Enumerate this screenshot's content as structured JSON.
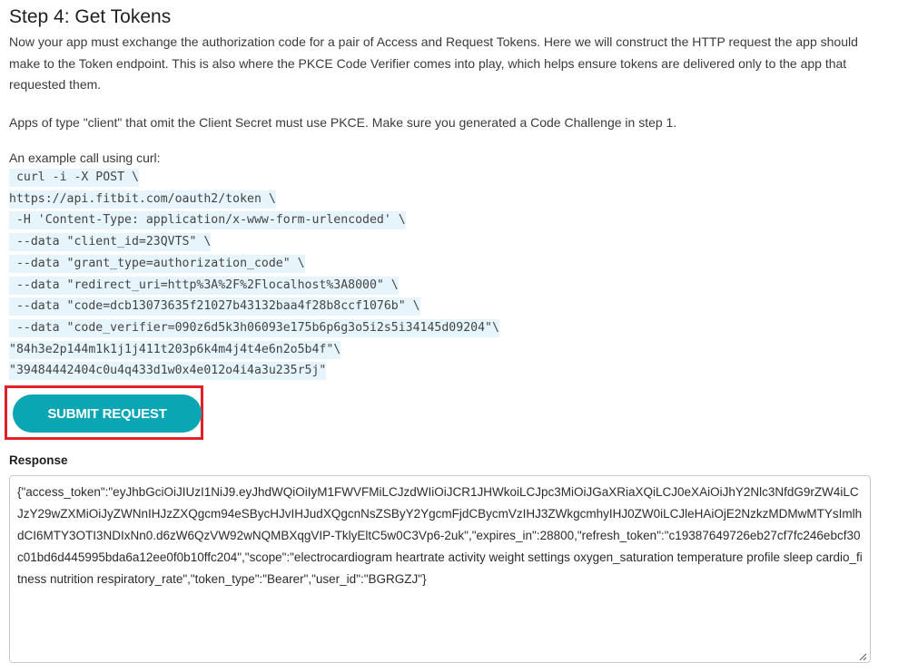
{
  "step": {
    "title": "Step 4: Get Tokens",
    "intro": "Now your app must exchange the authorization code for a pair of Access and Request Tokens. Here we will construct the HTTP request the app should make to the Token endpoint. This is also where the PKCE Code Verifier comes into play, which helps ensure tokens are delivered only to the app that requested them.",
    "pkce_note": "Apps of type \"client\" that omit the Client Secret must use PKCE. Make sure you generated a Code Challenge in step 1.",
    "example_label": "An example call using curl:"
  },
  "code": {
    "lines": [
      " curl -i -X POST \\",
      "https://api.fitbit.com/oauth2/token \\",
      " -H 'Content-Type: application/x-www-form-urlencoded' \\",
      " --data \"client_id=23QVTS\" \\",
      " --data \"grant_type=authorization_code\" \\",
      " --data \"redirect_uri=http%3A%2F%2Flocalhost%3A8000\" \\",
      " --data \"code=dcb13073635f21027b43132baa4f28b8ccf1076b\" \\",
      " --data \"code_verifier=090z6d5k3h06093e175b6p6g3o5i2s5i34145d09204\"\\",
      "\"84h3e2p144m1k1j1j411t203p6k4m4j4t4e6n2o5b4f\"\\",
      "\"39484442404c0u4q433d1w0x4e012o4i4a3u235r5j\""
    ]
  },
  "actions": {
    "submit_label": "SUBMIT REQUEST"
  },
  "response": {
    "label": "Response",
    "value": "{\"access_token\":\"eyJhbGciOiJIUzI1NiJ9.eyJhdWQiOiIyM1FWVFMiLCJzdWIiOiJCR1JHWkoiLCJpc3MiOiJGaXRiaXQiLCJ0eXAiOiJhY2Nlc3NfdG9rZW4iLCJzY29wZXMiOiJyZWNnIHJzZXQgcm94eSBycHJvIHJudXQgcnNsZSByY2YgcmFjdCBycmVzIHJ3ZWkgcmhyIHJ0ZW0iLCJleHAiOjE2NzkzMDMwMTYsImlhdCI6MTY3OTI3NDIxNn0.d6zW6QzVW92wNQMBXqgVIP-TklyEltC5w0C3Vp6-2uk\",\"expires_in\":28800,\"refresh_token\":\"c19387649726eb27cf7fc246ebcf30c01bd6d445995bda6a12ee0f0b10ffc204\",\"scope\":\"electrocardiogram heartrate activity weight settings oxygen_saturation temperature profile sleep cardio_fitness nutrition respiratory_rate\",\"token_type\":\"Bearer\",\"user_id\":\"BGRGZJ\"}"
  },
  "colors": {
    "accent": "#0aa6b3",
    "highlight_border": "#e0202a",
    "code_background": "#e6f5fb"
  }
}
